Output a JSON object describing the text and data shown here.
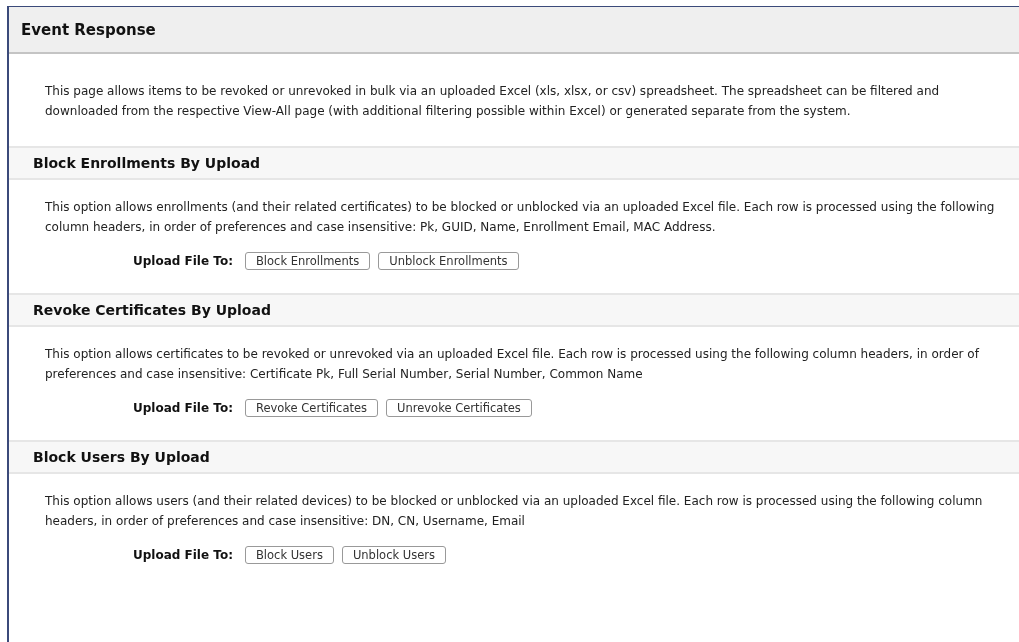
{
  "title": "Event Response",
  "intro": "This page allows items to be revoked or unrevoked in bulk via an uploaded Excel (xls, xlsx, or csv) spreadsheet. The spreadsheet can be filtered and downloaded from the respective View-All page (with additional filtering possible within Excel) or generated separate from the system.",
  "sections": [
    {
      "heading": "Block Enrollments By Upload",
      "description": "This option allows enrollments (and their related certificates) to be blocked or unblocked via an uploaded Excel file. Each row is processed using the following column headers, in order of preferences and case insensitive: Pk, GUID, Name, Enrollment Email, MAC Address.",
      "upload_label": "Upload File To:",
      "buttons": [
        "Block Enrollments",
        "Unblock Enrollments"
      ]
    },
    {
      "heading": "Revoke Certificates By Upload",
      "description": "This option allows certificates to be revoked or unrevoked via an uploaded Excel file. Each row is processed using the following column headers, in order of preferences and case insensitive: Certificate Pk, Full Serial Number, Serial Number, Common Name",
      "upload_label": "Upload File To:",
      "buttons": [
        "Revoke Certificates",
        "Unrevoke Certificates"
      ]
    },
    {
      "heading": "Block Users By Upload",
      "description": "This option allows users (and their related devices) to be blocked or unblocked via an uploaded Excel file. Each row is processed using the following column headers, in order of preferences and case insensitive: DN, CN, Username, Email",
      "upload_label": "Upload File To:",
      "buttons": [
        "Block Users",
        "Unblock Users"
      ]
    }
  ]
}
